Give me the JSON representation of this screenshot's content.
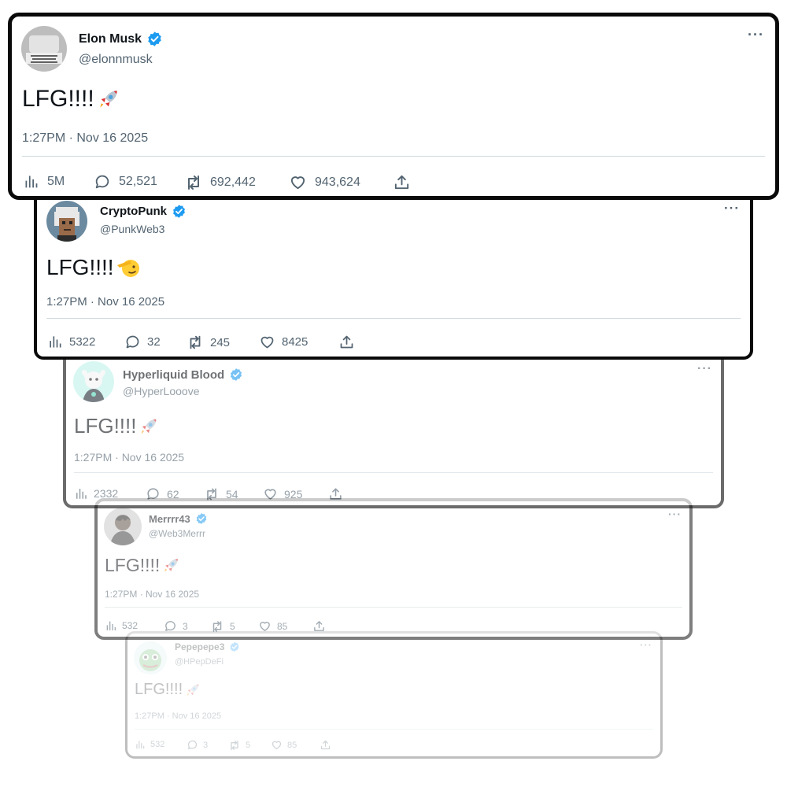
{
  "tweets": [
    {
      "name": "Elon Musk",
      "handle": "@elonnmusk",
      "text": "LFG!!!!",
      "emoji_icon": "rocket-emoji-icon",
      "time": "1:27PM · Nov 16 2025",
      "views": "5M",
      "replies": "52,521",
      "retweets": "692,442",
      "likes": "943,624",
      "more": "···"
    },
    {
      "name": "CryptoPunk",
      "handle": "@PunkWeb3",
      "text": "LFG!!!!",
      "emoji_icon": "saluting-face-emoji-icon",
      "time": "1:27PM · Nov 16 2025",
      "views": "5322",
      "replies": "32",
      "retweets": "245",
      "likes": "8425",
      "more": "···"
    },
    {
      "name": "Hyperliquid Blood",
      "handle": "@HyperLooove",
      "text": "LFG!!!!",
      "emoji_icon": "rocket-emoji-icon",
      "time": "1:27PM · Nov 16 2025",
      "views": "2332",
      "replies": "62",
      "retweets": "54",
      "likes": "925",
      "more": "···"
    },
    {
      "name": "Merrrr43",
      "handle": "@Web3Merrr",
      "text": "LFG!!!!",
      "emoji_icon": "rocket-emoji-icon",
      "time": "1:27PM · Nov 16 2025",
      "views": "532",
      "replies": "3",
      "retweets": "5",
      "likes": "85",
      "more": "···"
    },
    {
      "name": "Pepepepe3",
      "handle": "@HPepDeFi",
      "text": "LFG!!!!",
      "emoji_icon": "rocket-emoji-icon",
      "time": "1:27PM · Nov 16 2025",
      "views": "532",
      "replies": "3",
      "retweets": "5",
      "likes": "85",
      "more": "···"
    }
  ],
  "colors": {
    "verified_blue": "#1d9bf0",
    "muted_text": "#536471",
    "border": "#0a0a0a"
  }
}
